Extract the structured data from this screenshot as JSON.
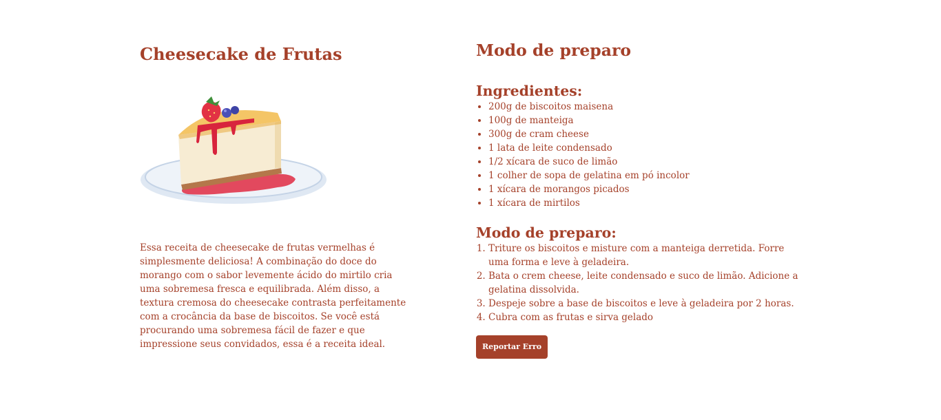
{
  "recipe": {
    "title": "Cheesecake de Frutas",
    "image_alt": "cheesecake-slice-illustration",
    "description": "Essa receita de cheesecake de frutas vermelhas é simplesmente deliciosa! A combinação do doce do morango com o sabor levemente ácido do mirtilo cria uma sobremesa fresca e equilibrada. Além disso, a textura cremosa do cheesecake contrasta perfeitamente com a crocância da base de biscoitos. Se você está procurando uma sobremesa fácil de fazer e que impressione seus convidados, essa é a receita ideal."
  },
  "preparation": {
    "heading": "Modo de preparo",
    "ingredients_heading": "Ingredientes:",
    "ingredients": [
      "200g de biscoitos maisena",
      "100g de manteiga",
      "300g de cram cheese",
      "1 lata de leite condensado",
      "1/2 xícara de suco de limão",
      "1 colher de sopa de gelatina em pó incolor",
      "1 xícara de morangos picados",
      "1 xícara de mirtilos"
    ],
    "steps_heading": "Modo de preparo:",
    "steps": [
      "Triture os biscoitos e misture com a manteiga derretida. Forre uma forma e leve à geladeira.",
      "Bata o crem cheese, leite condensado e suco de limão. Adicione a gelatina dissolvida.",
      "Despeje sobre a base de biscoitos e leve à geladeira por 2 horas.",
      "Cubra com as frutas e sirva gelado"
    ],
    "report_button_label": "Reportar Erro"
  },
  "colors": {
    "accent": "#a5412a",
    "background": "#ffffff"
  }
}
